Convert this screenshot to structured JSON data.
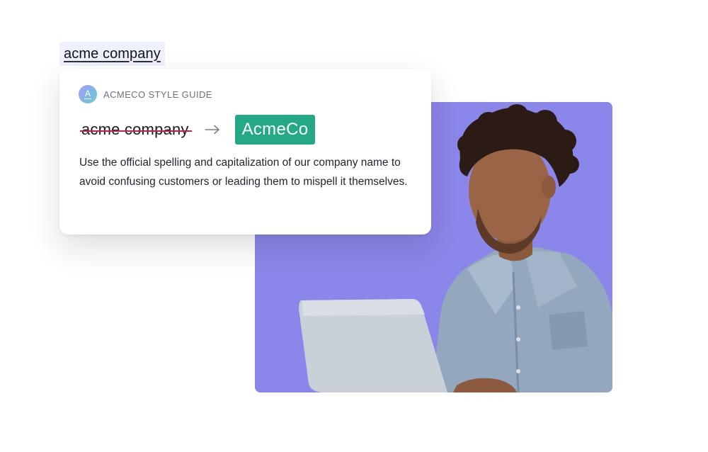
{
  "highlighted_text": "acme company",
  "card": {
    "logo_letter": "A",
    "title": "ACMECO STYLE GUIDE",
    "original_term": "acme company",
    "suggested_term": "AcmeCo",
    "description": "Use the official spelling and capitalization of our company name to avoid confusing customers or leading them to mispell it themselves."
  },
  "icons": {
    "arrow": "arrow-right-icon",
    "logo": "style-guide-logo-icon"
  },
  "colors": {
    "highlight_bg": "#eef0fb",
    "strike": "#c0224a",
    "suggestion": "#24a886",
    "photo_bg": "#8b86e9"
  }
}
